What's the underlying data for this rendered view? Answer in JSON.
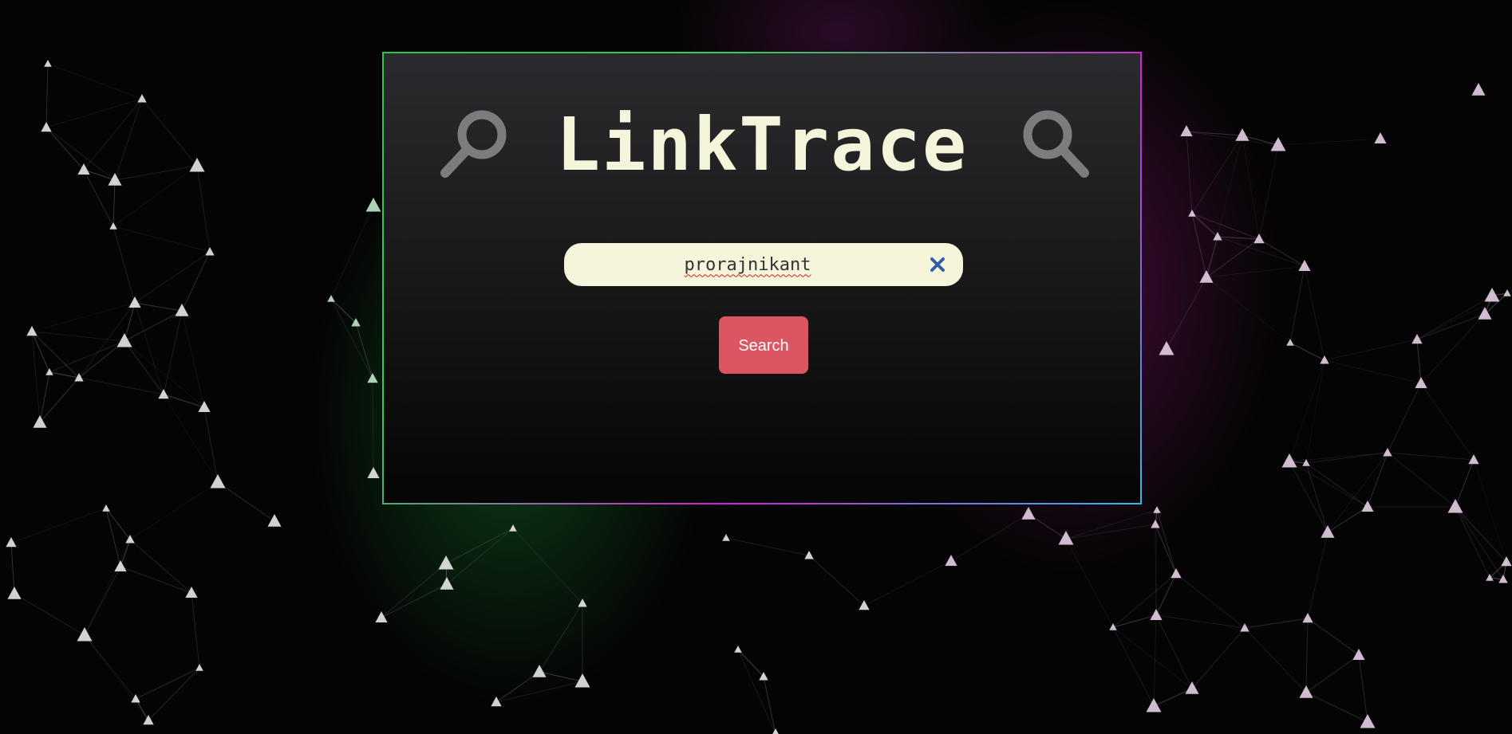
{
  "app": {
    "title": "LinkTrace"
  },
  "search": {
    "value": "prorajnikant",
    "button_label": "Search"
  },
  "icons": {
    "left": "magnifying-glass-icon",
    "right": "magnifying-glass-icon",
    "clear": "close-icon"
  },
  "colors": {
    "title": "#f5f5dc",
    "search_box_bg": "#f5f5dc",
    "search_button_bg": "#dc5562",
    "clear_icon": "#2f5fa8",
    "border_green": "#25c94b",
    "border_magenta": "#d61fd9",
    "border_cyan": "#2fb9e8"
  }
}
